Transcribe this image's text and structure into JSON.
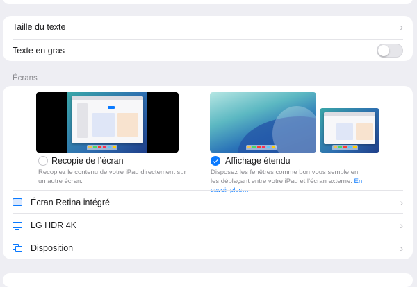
{
  "text_settings": {
    "text_size_label": "Taille du texte",
    "bold_text_label": "Texte en gras",
    "bold_text_on": false
  },
  "screens": {
    "header": "Écrans",
    "mirror": {
      "title": "Recopie de l’écran",
      "description": "Recopiez le contenu de votre iPad directement sur un autre écran.",
      "selected": false
    },
    "extended": {
      "title": "Affichage étendu",
      "description": "Disposez les fenêtres comme bon vous semble en les déplaçant entre votre iPad et l’écran externe.",
      "link": "En savoir plus…",
      "selected": true
    },
    "items": [
      {
        "label": "Écran Retina intégré",
        "icon": "ipad-display-icon"
      },
      {
        "label": "LG HDR 4K",
        "icon": "external-monitor-icon"
      },
      {
        "label": "Disposition",
        "icon": "arrangement-icon"
      }
    ]
  },
  "colors": {
    "accent": "#0a7aff",
    "background": "#eeeef3",
    "card": "#ffffff"
  }
}
